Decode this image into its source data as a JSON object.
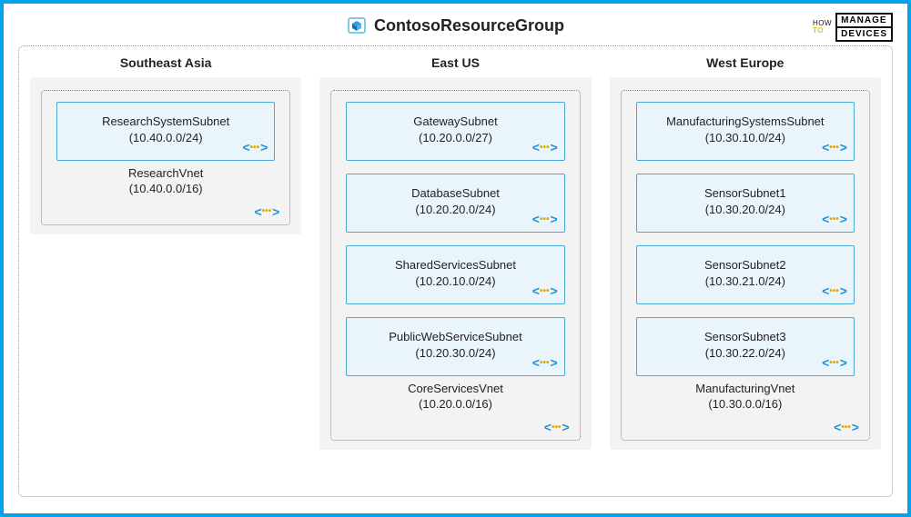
{
  "header": {
    "title": "ContosoResourceGroup",
    "brand_how": "HOW",
    "brand_to": "TO",
    "brand_manage": "MANAGE",
    "brand_devices": "DEVICES"
  },
  "regions": [
    {
      "title": "Southeast Asia",
      "vnet": {
        "name": "ResearchVnet",
        "cidr": "(10.40.0.0/16)"
      },
      "subnets": [
        {
          "name": "ResearchSystemSubnet",
          "cidr": "(10.40.0.0/24)"
        }
      ]
    },
    {
      "title": "East US",
      "vnet": {
        "name": "CoreServicesVnet",
        "cidr": "(10.20.0.0/16)"
      },
      "subnets": [
        {
          "name": "GatewaySubnet",
          "cidr": "(10.20.0.0/27)"
        },
        {
          "name": "DatabaseSubnet",
          "cidr": "(10.20.20.0/24)"
        },
        {
          "name": "SharedServicesSubnet",
          "cidr": "(10.20.10.0/24)"
        },
        {
          "name": "PublicWebServiceSubnet",
          "cidr": "(10.20.30.0/24)"
        }
      ]
    },
    {
      "title": "West Europe",
      "vnet": {
        "name": "ManufacturingVnet",
        "cidr": "(10.30.0.0/16)"
      },
      "subnets": [
        {
          "name": "ManufacturingSystemsSubnet",
          "cidr": "(10.30.10.0/24)"
        },
        {
          "name": "SensorSubnet1",
          "cidr": "(10.30.20.0/24)"
        },
        {
          "name": "SensorSubnet2",
          "cidr": "(10.30.21.0/24)"
        },
        {
          "name": "SensorSubnet3",
          "cidr": "(10.30.22.0/24)"
        }
      ]
    }
  ]
}
